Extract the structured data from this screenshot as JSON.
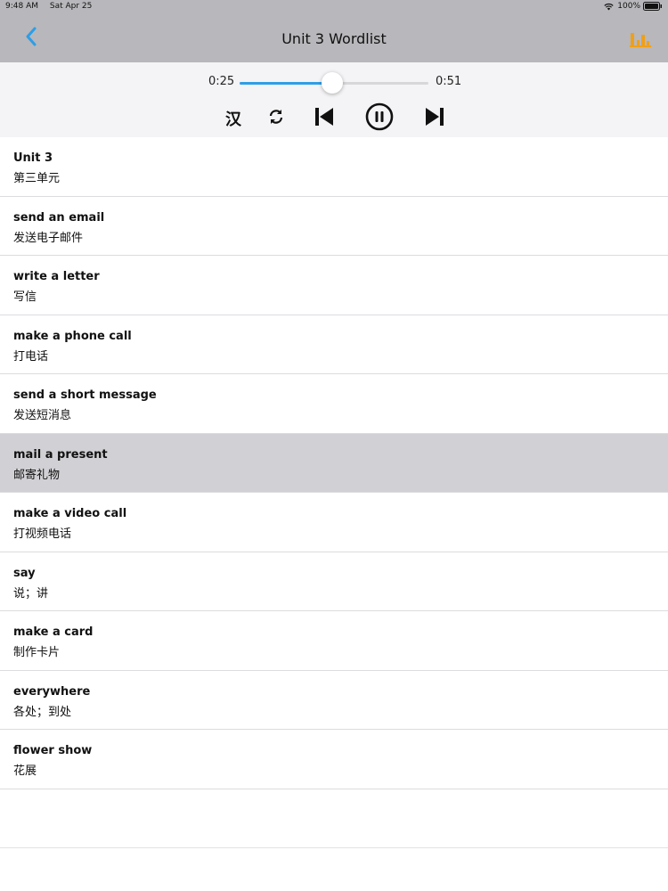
{
  "status_bar": {
    "time": "9:48 AM",
    "date": "Sat Apr 25",
    "battery": "100%"
  },
  "nav": {
    "title": "Unit 3 Wordlist",
    "back_icon": "chevron-left-icon",
    "stats_icon": "bar-chart-icon",
    "accent": "#2e9ee6",
    "stats_color": "#f0a018"
  },
  "player": {
    "current_time": "0:25",
    "total_time": "0:51",
    "progress": 0.49,
    "lang_toggle": "汉",
    "controls": [
      "repeat-icon",
      "previous-icon",
      "pause-icon",
      "next-icon"
    ]
  },
  "words": [
    {
      "en": "Unit 3",
      "zh": "第三单元"
    },
    {
      "en": "send an email",
      "zh": "发送电子邮件"
    },
    {
      "en": "write a letter",
      "zh": "写信"
    },
    {
      "en": "make a phone call",
      "zh": "打电话"
    },
    {
      "en": "send a short message",
      "zh": "发送短消息"
    },
    {
      "en": "mail a present",
      "zh": "邮寄礼物"
    },
    {
      "en": "make a video call",
      "zh": "打视频电话"
    },
    {
      "en": "say",
      "zh": "说；讲"
    },
    {
      "en": "make a card",
      "zh": "制作卡片"
    },
    {
      "en": "everywhere",
      "zh": "各处；到处"
    },
    {
      "en": "flower show",
      "zh": "花展"
    }
  ],
  "selected_index": 5
}
